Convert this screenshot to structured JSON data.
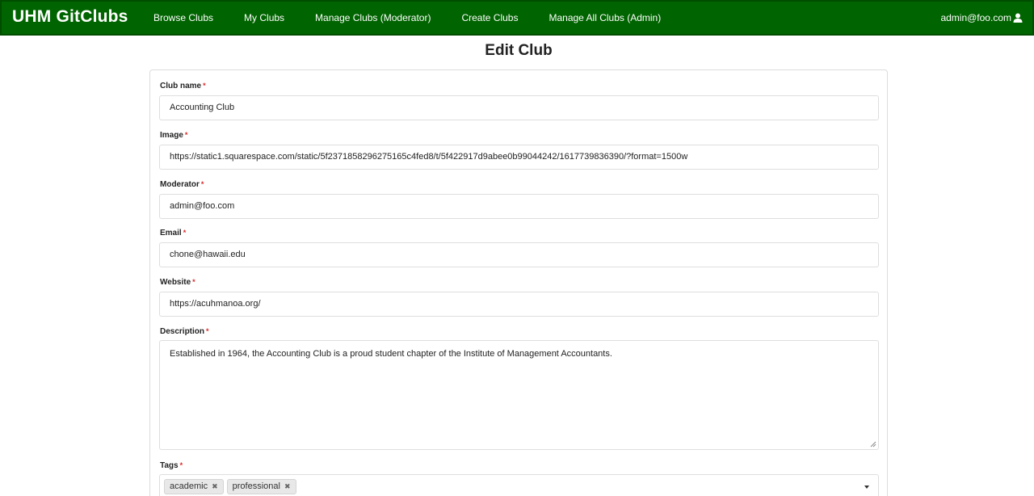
{
  "navbar": {
    "brand": "UHM GitClubs",
    "links": [
      "Browse Clubs",
      "My Clubs",
      "Manage Clubs (Moderator)",
      "Create Clubs",
      "Manage All Clubs (Admin)"
    ],
    "user": "admin@foo.com",
    "user_icon": "user-icon"
  },
  "page": {
    "title": "Edit Club"
  },
  "form": {
    "required_mark": "*",
    "club_name": {
      "label": "Club name",
      "value": "Accounting Club"
    },
    "image": {
      "label": "Image",
      "value": "https://static1.squarespace.com/static/5f2371858296275165c4fed8/t/5f422917d9abee0b99044242/1617739836390/?format=1500w"
    },
    "moderator": {
      "label": "Moderator",
      "value": "admin@foo.com"
    },
    "email": {
      "label": "Email",
      "value": "chone@hawaii.edu"
    },
    "website": {
      "label": "Website",
      "value": "https://acuhmanoa.org/"
    },
    "description": {
      "label": "Description",
      "value": "Established in 1964, the Accounting Club is a proud student chapter of the Institute of Management Accountants."
    },
    "tags": {
      "label": "Tags",
      "values": [
        "academic",
        "professional"
      ],
      "remove_glyph": "✖"
    }
  },
  "colors": {
    "navbar": "#006400",
    "required": "#db2828"
  }
}
